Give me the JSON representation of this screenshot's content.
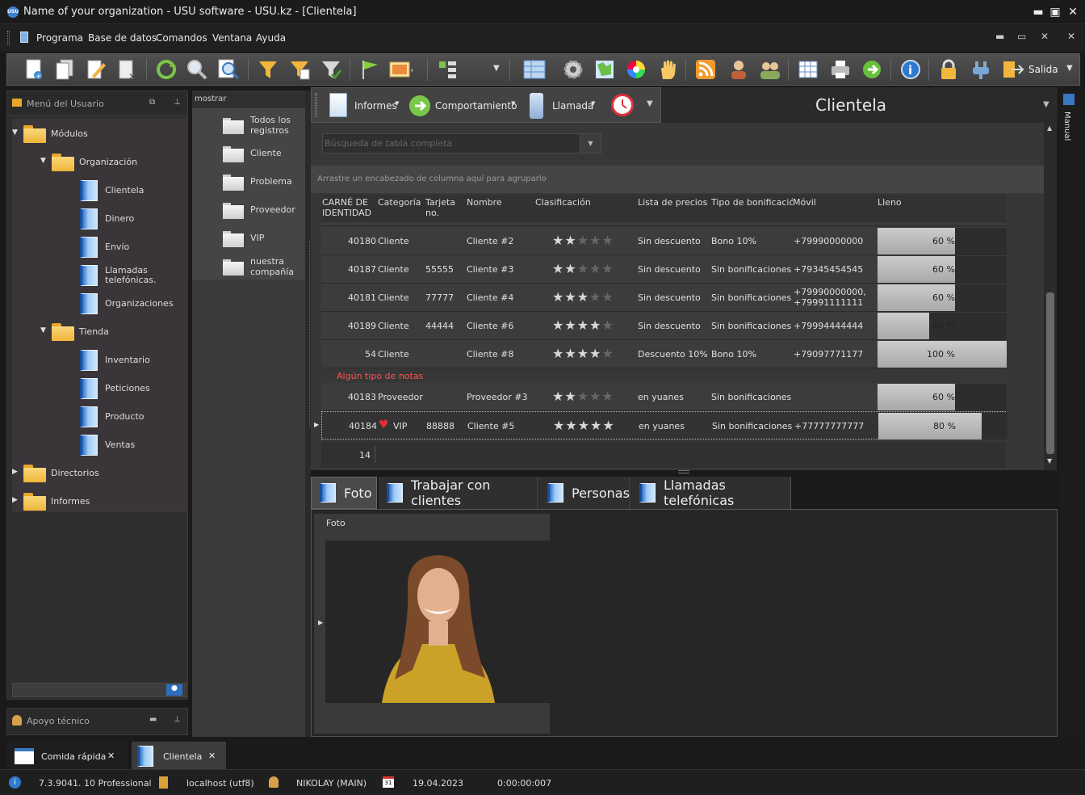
{
  "window": {
    "title": "Name of your organization - USU software - USU.kz - [Clientela]",
    "logo_text": "USU",
    "minimize": "▬",
    "maximize": "▣",
    "close": "✕"
  },
  "menu": {
    "items": [
      "Programa",
      "Base de datos",
      "Comandos",
      "Ventana",
      "Ayuda"
    ],
    "controls": [
      "▬",
      "▭",
      "✕"
    ]
  },
  "toolbar": {
    "salida_label": "Salida",
    "icons": [
      "new-document-icon",
      "copy-document-icon",
      "edit-document-icon",
      "delete-document-icon",
      "refresh-icon",
      "search-icon",
      "find-icon",
      "filter-icon",
      "filter-edit-icon",
      "filter-clear-icon",
      "flag-icon",
      "image-icon",
      "tree-icon",
      "grid-icon",
      "settings-icon",
      "map-icon",
      "color-wheel-icon",
      "hand-icon",
      "rss-icon",
      "user-icon",
      "users-icon",
      "table-icon",
      "print-icon",
      "go-icon",
      "info-icon",
      "lock-icon",
      "plugin-icon",
      "exit-icon"
    ]
  },
  "left_panel": {
    "title": "Menú del Usuario",
    "tree": [
      {
        "label": "Módulos",
        "kind": "folder",
        "level": 0,
        "expanded": true
      },
      {
        "label": "Organización",
        "kind": "folder",
        "level": 1,
        "expanded": true
      },
      {
        "label": "Clientela",
        "kind": "book",
        "level": 2
      },
      {
        "label": "Dinero",
        "kind": "book",
        "level": 2
      },
      {
        "label": "Envío",
        "kind": "book",
        "level": 2
      },
      {
        "label": "Llamadas telefónicas.",
        "kind": "book",
        "level": 2
      },
      {
        "label": "Organizaciones",
        "kind": "book",
        "level": 2
      },
      {
        "label": "Tienda",
        "kind": "folder",
        "level": 1,
        "expanded": true
      },
      {
        "label": "Inventario",
        "kind": "book",
        "level": 2
      },
      {
        "label": "Peticiones",
        "kind": "book",
        "level": 2
      },
      {
        "label": "Producto",
        "kind": "book",
        "level": 2
      },
      {
        "label": "Ventas",
        "kind": "book",
        "level": 2
      },
      {
        "label": "Directorios",
        "kind": "folder",
        "level": 0,
        "expanded": false
      },
      {
        "label": "Informes",
        "kind": "folder",
        "level": 0,
        "expanded": false
      }
    ],
    "support_title": "Apoyo técnico"
  },
  "show_panel": {
    "title": "mostrar",
    "items": [
      "Todos los registros",
      "Cliente",
      "Problema",
      "Proveedor",
      "VIP",
      "nuestra compañía"
    ]
  },
  "grid_toolbar": {
    "informes": "Informes",
    "comportamiento": "Comportamiento",
    "llamada": "Llamada",
    "module_title": "Clientela"
  },
  "grid": {
    "search_placeholder": "Búsqueda de tabla completa",
    "group_hint": "Arrastre un encabezado de columna aquí para agruparlo",
    "columns": [
      "CARNÉ DE IDENTIDAD",
      "Categoría",
      "Tarjeta no.",
      "Nombre",
      "Clasificación",
      "Lista de precios",
      "Tipo de bonificación",
      "Móvil",
      "Lleno"
    ],
    "rows": [
      {
        "id": "40180",
        "categoria": "Cliente",
        "tarjeta": "",
        "nombre": "Cliente #2",
        "rating": 2,
        "lista": "Sin descuento",
        "bonif": "Bono 10%",
        "movil": "+79990000000",
        "lleno": 60,
        "lleno_text": "60 %"
      },
      {
        "id": "40187",
        "categoria": "Cliente",
        "tarjeta": "55555",
        "nombre": "Cliente #3",
        "rating": 2,
        "lista": "Sin descuento",
        "bonif": "Sin bonificaciones",
        "movil": "+79345454545",
        "lleno": 60,
        "lleno_text": "60 %"
      },
      {
        "id": "40181",
        "categoria": "Cliente",
        "tarjeta": "77777",
        "nombre": "Cliente #4",
        "rating": 3,
        "lista": "Sin descuento",
        "bonif": "Sin bonificaciones",
        "movil": "+79990000000, +79991111111",
        "lleno": 60,
        "lleno_text": "60 %"
      },
      {
        "id": "40189",
        "categoria": "Cliente",
        "tarjeta": "44444",
        "nombre": "Cliente #6",
        "rating": 4,
        "lista": "Sin descuento",
        "bonif": "Sin bonificaciones",
        "movil": "+79994444444",
        "lleno": 40,
        "lleno_text": "40 %"
      },
      {
        "id": "54",
        "categoria": "Cliente",
        "tarjeta": "",
        "nombre": "Cliente #8",
        "rating": 4,
        "lista": "Descuento 10%",
        "bonif": "Bono 10%",
        "movil": "+79097771177",
        "lleno": 100,
        "lleno_text": "100 %"
      }
    ],
    "note": "Algún tipo de notas",
    "rows2": [
      {
        "id": "40183",
        "categoria": "Proveedor",
        "tarjeta": "",
        "nombre": "Proveedor #3",
        "rating": 2,
        "lista": "en yuanes",
        "bonif": "Sin bonificaciones",
        "movil": "",
        "lleno": 60,
        "lleno_text": "60 %"
      },
      {
        "id": "40184",
        "categoria": "VIP",
        "tarjeta": "88888",
        "nombre": "Cliente #5",
        "rating": 5,
        "lista": "en yuanes",
        "bonif": "Sin bonificaciones",
        "movil": "+77777777777",
        "lleno": 80,
        "lleno_text": "80 %"
      }
    ],
    "count": "14"
  },
  "tabs": [
    "Foto",
    "Trabajar con clientes",
    "Personas",
    "Llamadas telefónicas"
  ],
  "detail": {
    "photo_label": "Foto"
  },
  "side_tab": "Manual",
  "bottom_tabs": [
    {
      "label": "Comida rápida",
      "close": "✕"
    },
    {
      "label": "Clientela",
      "close": "✕"
    }
  ],
  "status": {
    "version": "7.3.9041. 10 Professional",
    "db": "localhost (utf8)",
    "user": "NIKOLAY (MAIN)",
    "calendar_day": "31",
    "date": "19.04.2023",
    "timer": "0:00:00:007"
  },
  "colors": {
    "accent_red": "#e0303a",
    "note_red": "#ff5252",
    "bar_fill": "#bdbdbd"
  }
}
